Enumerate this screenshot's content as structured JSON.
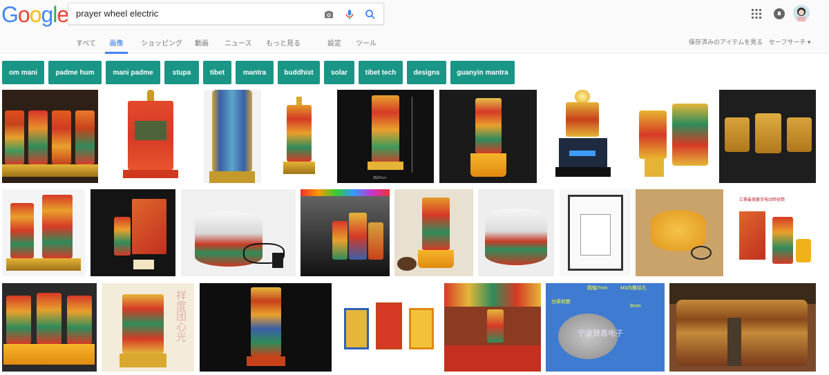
{
  "logo": {
    "letters": [
      "G",
      "o",
      "o",
      "g",
      "l",
      "e"
    ],
    "colors": [
      "#4285f4",
      "#ea4335",
      "#fbbc05",
      "#4285f4",
      "#34a853",
      "#ea4335"
    ]
  },
  "search": {
    "value": "prayer wheel electric",
    "placeholder": ""
  },
  "icons": {
    "camera": "camera-icon",
    "mic": "mic-icon",
    "search": "search-icon",
    "apps": "apps-grid-icon",
    "notifications": "notifications-icon",
    "avatar": "account-avatar"
  },
  "tabs": [
    "すべて",
    "画像",
    "ショッピング",
    "動画",
    "ニュース",
    "もっと見る",
    "設定",
    "ツール"
  ],
  "active_tab": "画像",
  "right_links": {
    "saved": "保存済みのアイテムを見る",
    "safesearch": "セーフサーチ ▾"
  },
  "chips": [
    "om mani",
    "padme hum",
    "mani padme",
    "stupa",
    "tibet",
    "mantra",
    "buddhist",
    "solar",
    "tibet tech",
    "designs",
    "guanyin mantra"
  ],
  "colors": {
    "chip_bg": "#199686",
    "accent": "#4285f4"
  },
  "image_overlays": {
    "r1i5_caption": "高約5cm",
    "r3i2_text": "祥度团心光",
    "r3i6_text": "宁波賛嘉电子",
    "r3i6_label1": "圆轴7mm",
    "r3i6_label2": "M3内螺纹孔",
    "r3i6_label3": "8mm",
    "r3i6_label4": "功率转数",
    "r2i9_title": "汇豪最美龍寺电动转经筒"
  }
}
